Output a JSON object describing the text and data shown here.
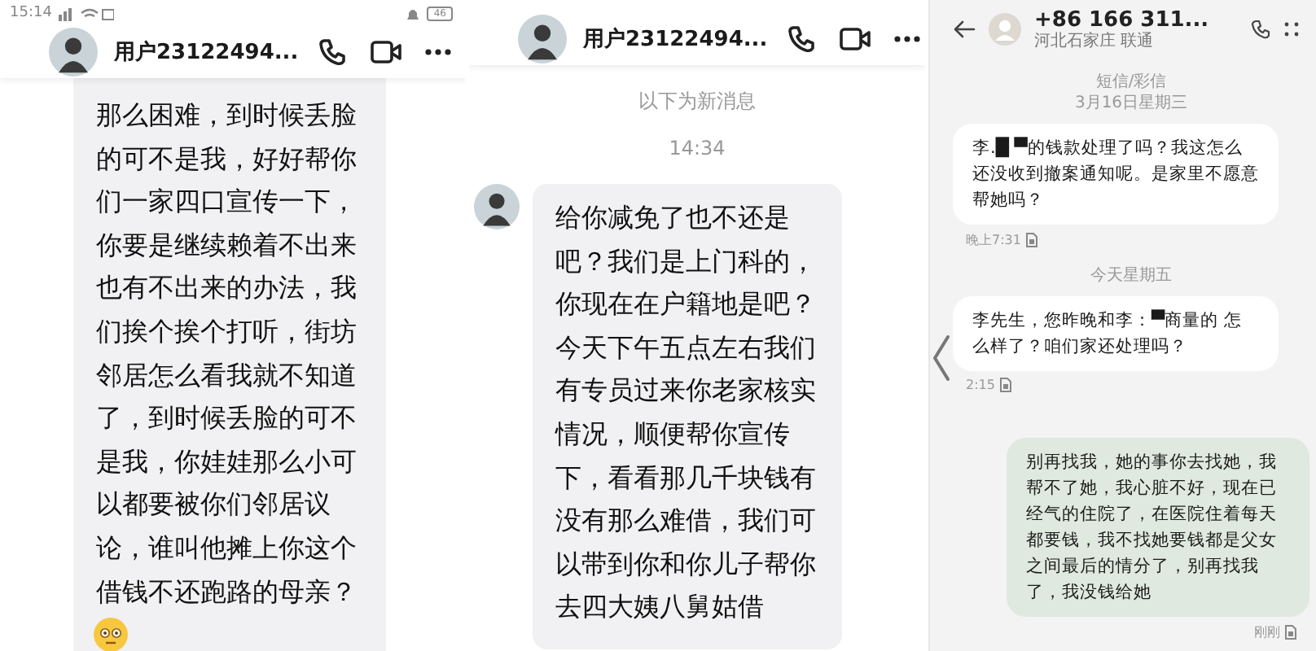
{
  "panels": [
    {
      "kind": "chat",
      "status_bar": {
        "time": "15:14",
        "battery": "46"
      },
      "header": {
        "title": "用户23122494..."
      },
      "items": [
        {
          "kind": "received",
          "avatar": false,
          "text": "那么困难，到时候丢脸的可不是我，好好帮你们一家四口宣传一下，你要是继续赖着不出来也有不出来的办法，我们挨个挨个打听，街坊邻居怎么看我就不知道了，到时候丢脸的可不是我，你娃娃那么小可以都要被你们邻居议论，谁叫他摊上你这个借钱不还跑路的母亲？"
        },
        {
          "kind": "emoji"
        }
      ]
    },
    {
      "kind": "chat",
      "header": {
        "title": "用户23122494..."
      },
      "items": [
        {
          "kind": "notice",
          "text": "以下为新消息"
        },
        {
          "kind": "notice",
          "text": "14:34"
        },
        {
          "kind": "received",
          "avatar": true,
          "text": "给你减免了也不还是吧？我们是上门科的，你现在在户籍地是吧？今天下午五点左右我们有专员过来你老家核实情况，顺便帮你宣传下，看看那几千块钱有没有那么难借，我们可以带到你和你儿子帮你去四大姨八舅姑借"
        }
      ]
    },
    {
      "kind": "sms",
      "header": {
        "title": "+86 166 311...",
        "subtitle": "河北石家庄 联通"
      },
      "items": [
        {
          "kind": "notice",
          "text": "短信/彩信"
        },
        {
          "kind": "notice",
          "text": "3月16日星期三"
        },
        {
          "kind": "received",
          "text": "李.█ ▀的钱款处理了吗？我这怎么还没收到撤案通知呢。是家里不愿意帮她吗？",
          "time": "晚上7:31"
        },
        {
          "kind": "notice",
          "text": "今天星期五"
        },
        {
          "kind": "received",
          "text": "李先生，您昨晚和李：▀商量的 怎么样了？咱们家还处理吗？",
          "time": "2:15"
        },
        {
          "kind": "sent",
          "text": "别再找我，她的事你去找她，我帮不了她，我心脏不好，现在已经气的住院了，在医院住着每天都要钱，我不找她要钱都是父女之间最后的情分了，别再找我了，我没钱给她",
          "time": "刚刚"
        }
      ]
    }
  ]
}
